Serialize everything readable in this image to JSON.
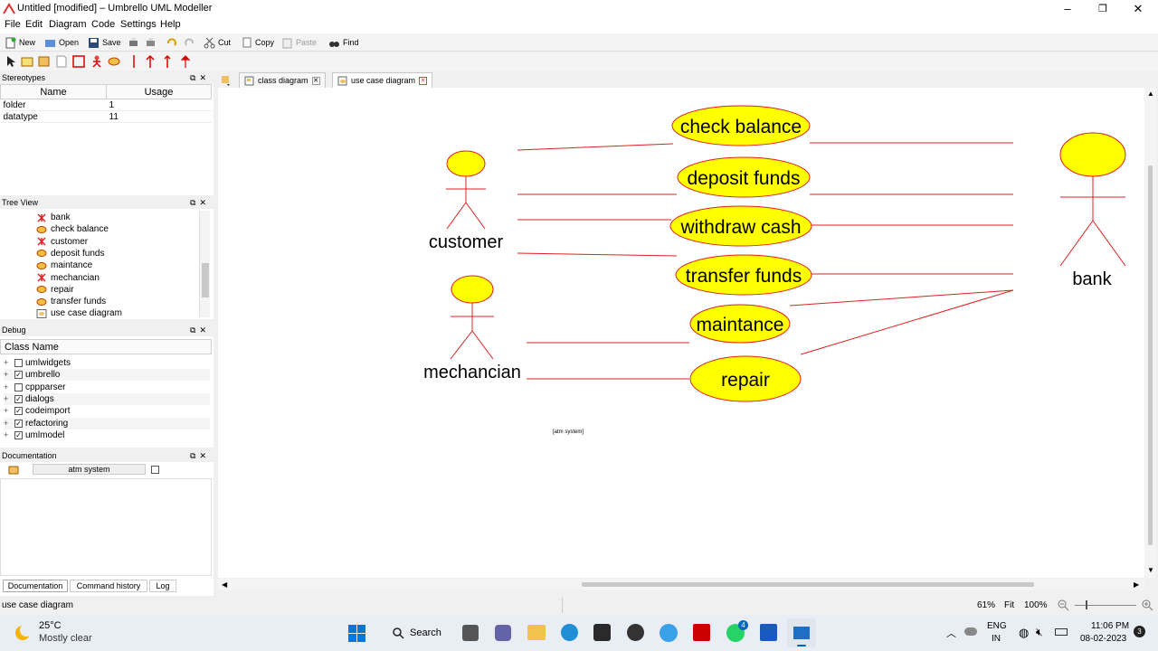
{
  "window": {
    "title": "Untitled [modified] – Umbrello UML Modeller",
    "controls": [
      "–",
      "❐",
      "✕"
    ]
  },
  "menu": [
    "File",
    "Edit",
    "Diagram",
    "Code",
    "Settings",
    "Help"
  ],
  "toolbar": {
    "new": "New",
    "open": "Open",
    "save": "Save",
    "cut": "Cut",
    "copy": "Copy",
    "paste": "Paste",
    "find": "Find"
  },
  "stereotypes": {
    "title": "Stereotypes",
    "col_name": "Name",
    "col_usage": "Usage",
    "rows": [
      {
        "name": "folder",
        "usage": "1"
      },
      {
        "name": "datatype",
        "usage": "11"
      }
    ]
  },
  "tree": {
    "title": "Tree View",
    "items": [
      {
        "label": "bank",
        "icon": "actor-icon"
      },
      {
        "label": "check balance",
        "icon": "usecase-icon"
      },
      {
        "label": "customer",
        "icon": "actor-icon"
      },
      {
        "label": "deposit funds",
        "icon": "usecase-icon"
      },
      {
        "label": "maintance",
        "icon": "usecase-icon"
      },
      {
        "label": "mechancian",
        "icon": "actor-icon"
      },
      {
        "label": "repair",
        "icon": "usecase-icon"
      },
      {
        "label": "transfer funds",
        "icon": "usecase-icon"
      },
      {
        "label": "use case diagram",
        "icon": "diagram-icon"
      }
    ]
  },
  "debug": {
    "title": "Debug",
    "header": "Class Name",
    "rows": [
      {
        "label": "umlwidgets",
        "checked": false
      },
      {
        "label": "umbrello",
        "checked": true
      },
      {
        "label": "cppparser",
        "checked": false
      },
      {
        "label": "dialogs",
        "checked": true
      },
      {
        "label": "codeimport",
        "checked": true
      },
      {
        "label": "refactoring",
        "checked": true
      },
      {
        "label": "umlmodel",
        "checked": true
      }
    ]
  },
  "documentation": {
    "title": "Documentation",
    "field": "atm system",
    "tabs": [
      "Documentation",
      "Command history",
      "Log"
    ]
  },
  "tabs": [
    {
      "label": "class diagram",
      "active": false
    },
    {
      "label": "use case diagram",
      "active": true
    }
  ],
  "diagram": {
    "actors": [
      "customer",
      "mechancian",
      "bank"
    ],
    "usecases": [
      "check balance",
      "deposit funds",
      "withdraw cash",
      "transfer funds",
      "maintance",
      "repair"
    ],
    "note": "[atm system]"
  },
  "status": {
    "text": "use case diagram",
    "zoom": "61%",
    "fit": "Fit",
    "hundred": "100%"
  },
  "taskbar": {
    "temp": "25°C",
    "weather": "Mostly clear",
    "search": "Search",
    "lang1": "ENG",
    "lang2": "IN",
    "time": "11:06 PM",
    "date": "08-02-2023",
    "notif": "3",
    "whatsapp_badge": "4"
  },
  "colors": {
    "uml_fill": "#ffff00",
    "uml_line": "#e02020",
    "accent": "#0067c0"
  }
}
